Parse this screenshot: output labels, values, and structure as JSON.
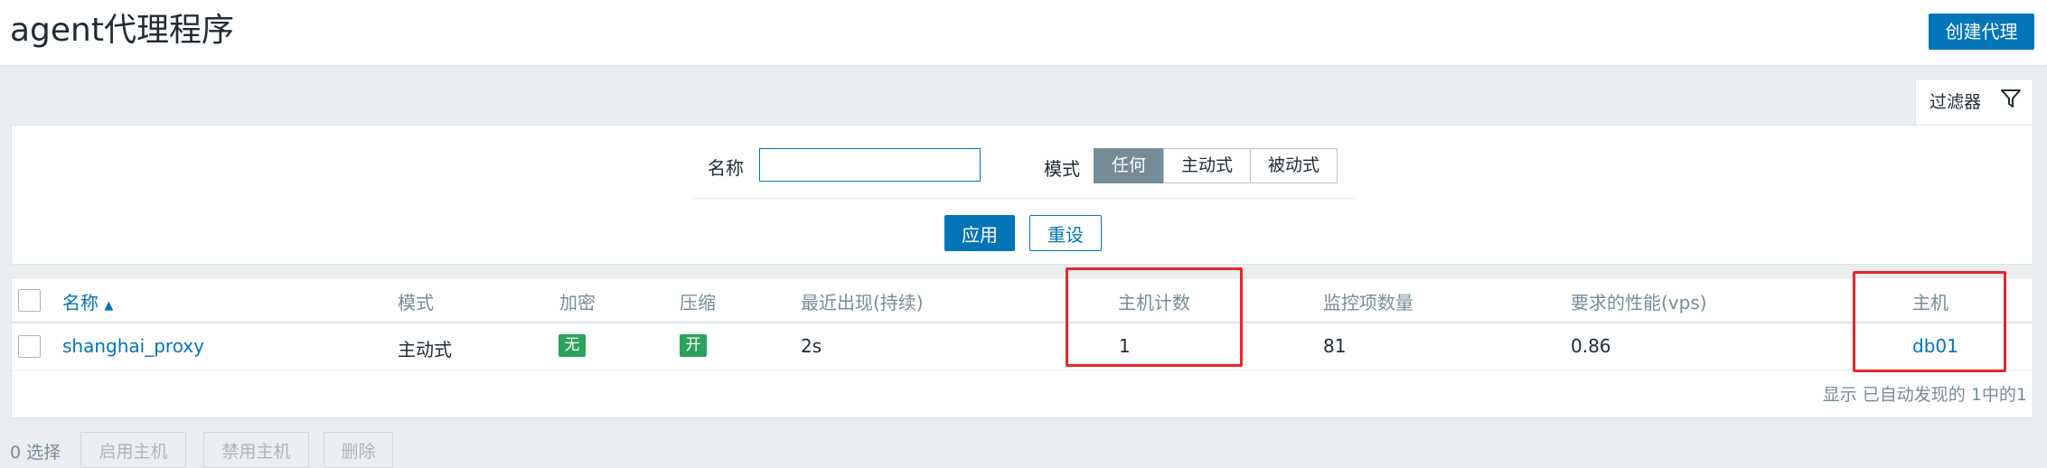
{
  "header": {
    "title": "agent代理程序",
    "create_button": "创建代理"
  },
  "filter": {
    "tab_label": "过滤器",
    "name_label": "名称",
    "name_value": "",
    "mode_label": "模式",
    "mode_options": [
      "任何",
      "主动式",
      "被动式"
    ],
    "mode_selected": "任何",
    "apply_button": "应用",
    "reset_button": "重设"
  },
  "table": {
    "columns": {
      "name": "名称",
      "sort_indicator": "▲",
      "mode": "模式",
      "encryption": "加密",
      "compression": "压缩",
      "last_seen": "最近出现(持续)",
      "host_count": "主机计数",
      "item_count": "监控项数量",
      "required_perf": "要求的性能(vps)",
      "hosts": "主机"
    },
    "rows": [
      {
        "name": "shanghai_proxy",
        "mode": "主动式",
        "encryption": "无",
        "compression": "开",
        "last_seen": "2s",
        "host_count": "1",
        "item_count": "81",
        "required_perf": "0.86",
        "hosts": "db01"
      }
    ],
    "footer": "显示 已自动发现的 1中的1"
  },
  "bulk_actions": {
    "selected_count": "0 选择",
    "enable_hosts": "启用主机",
    "disable_hosts": "禁用主机",
    "delete": "删除"
  },
  "colors": {
    "accent": "#0275b8",
    "badge_green": "#2aa25c",
    "annotation_red": "#e8262b"
  }
}
